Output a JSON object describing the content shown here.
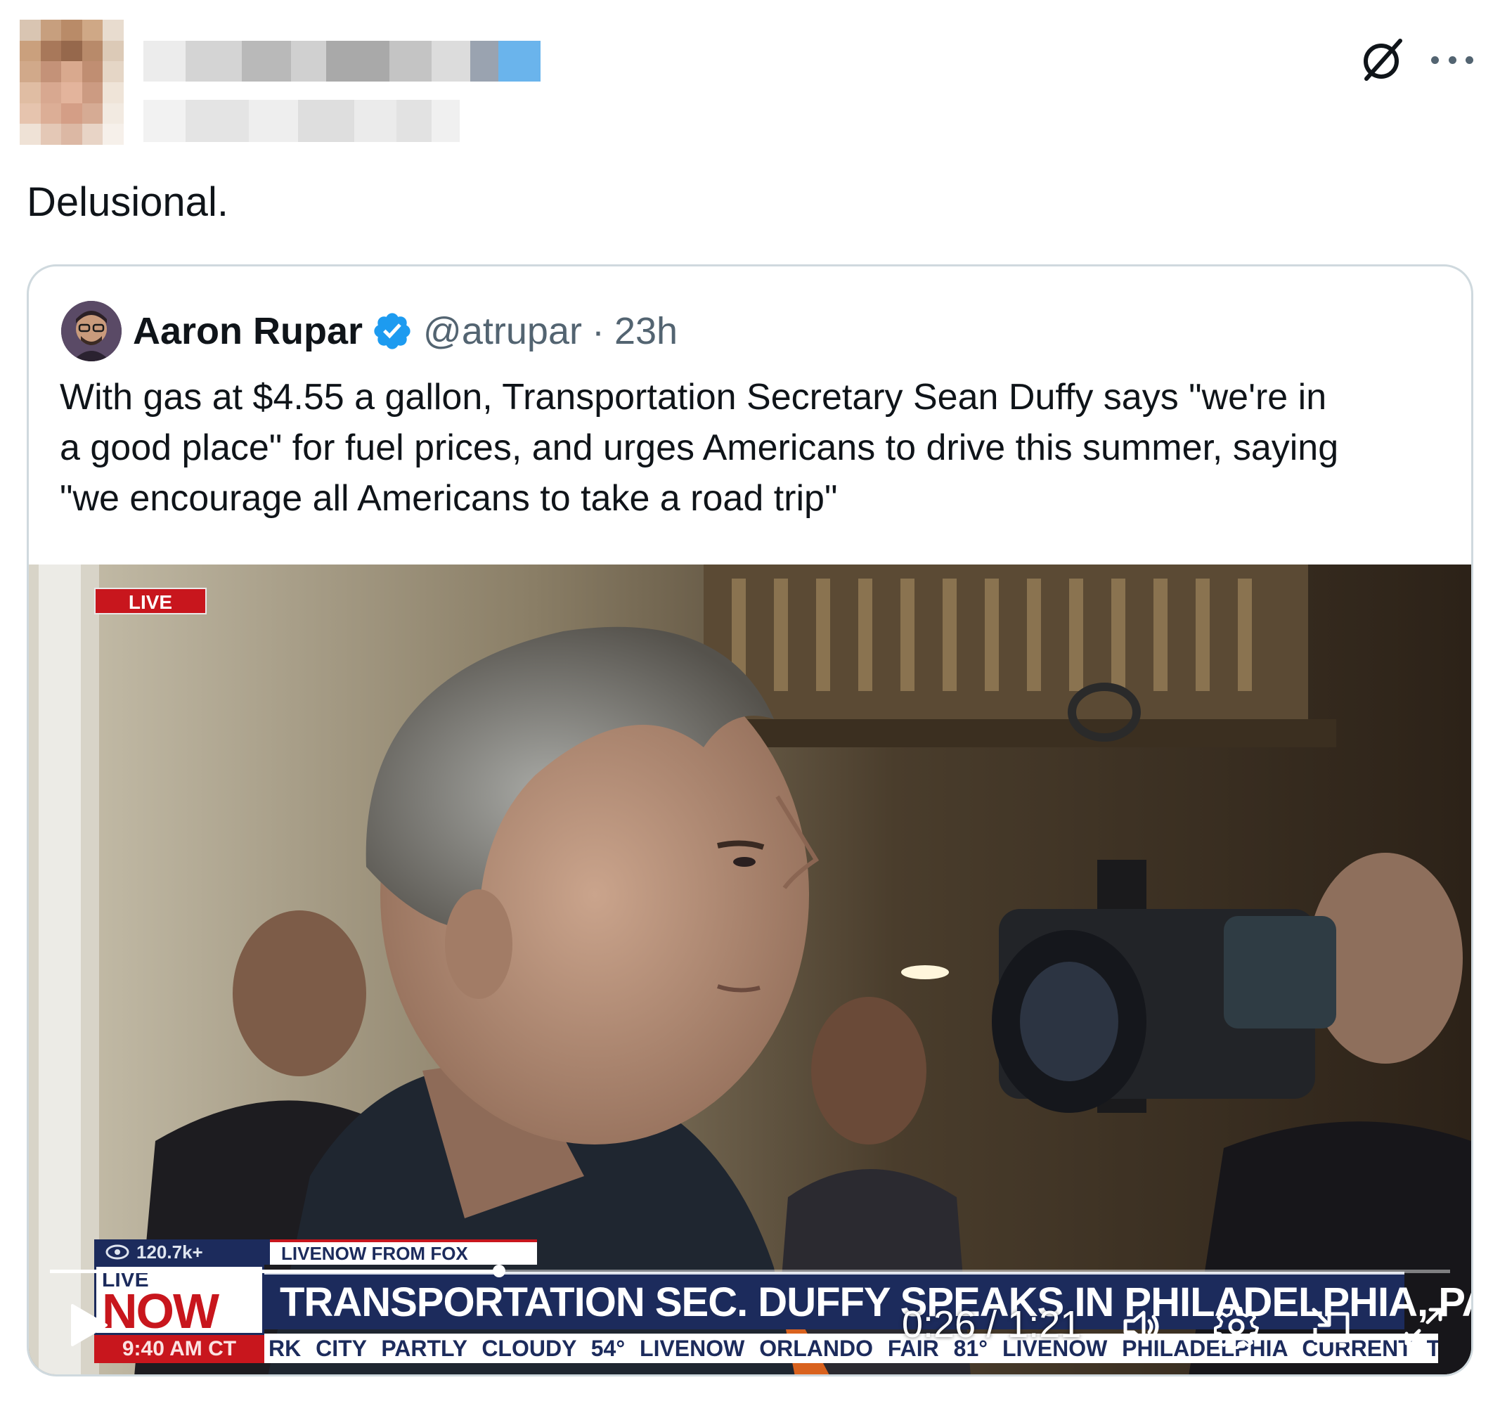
{
  "tweet": {
    "text": "Delusional."
  },
  "icons": {
    "grok": "grok-icon",
    "more": "more-icon",
    "verified": "verified-badge-icon",
    "play": "play-icon",
    "volume": "volume-icon",
    "settings": "gear-icon",
    "dock": "picture-in-picture-icon",
    "fullscreen": "fullscreen-icon"
  },
  "quoted_tweet": {
    "author_name": "Aaron Rupar",
    "handle": "@atrupar",
    "separator": "·",
    "time": "23h",
    "text_lines": [
      "With gas at $4.55 a gallon, Transportation Secretary Sean Duffy says \"we're in",
      "a good place\" for fuel prices, and urges Americans to drive this summer, saying",
      "\"we encourage all Americans to take a road trip\""
    ]
  },
  "video": {
    "live_tag": "LIVE",
    "views": "120.7k+",
    "livenow_from": "LIVENOW FROM FOX",
    "now_live": "LIVE",
    "now_word": "NOW",
    "now_time": "9:40 AM CT",
    "headline": "TRANSPORTATION SEC. DUFFY SPEAKS IN PHILADELPHIA, PA",
    "ticker": "RK CITY   PARTLY CLOUDY 54°   LIVENOW   ORLANDO   FAIR 81°   LIVENOW   PHILADELPHIA   CURRENT TEMPS",
    "current_time": "0:26",
    "time_separator": "/",
    "duration": "1:21",
    "progress": 0.321
  },
  "colors": {
    "text_primary": "#0f1419",
    "text_secondary": "#536471",
    "verified_blue": "#1d9bf0",
    "card_border": "#cfd9de",
    "fox_navy": "#1c2b5c",
    "fox_red": "#c8161d"
  }
}
